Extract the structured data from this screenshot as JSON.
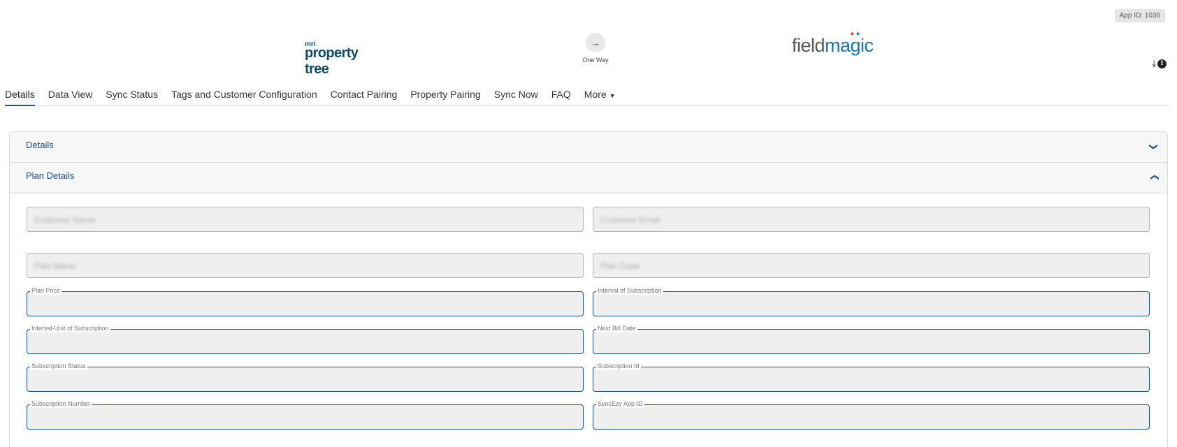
{
  "app_id": "App ID: 1036",
  "header": {
    "left_logo_prefix": "mri",
    "left_logo_name": "property tree",
    "sync_direction_label": "One Way",
    "right_logo_part1": "field",
    "right_logo_part2": "magic"
  },
  "tabs": [
    {
      "label": "Details"
    },
    {
      "label": "Data View"
    },
    {
      "label": "Sync Status"
    },
    {
      "label": "Tags and Customer Configuration"
    },
    {
      "label": "Contact Pairing"
    },
    {
      "label": "Property Pairing"
    },
    {
      "label": "Sync Now"
    },
    {
      "label": "FAQ"
    },
    {
      "label": "More"
    }
  ],
  "accordion": {
    "details_title": "Details",
    "plan_details_title": "Plan Details"
  },
  "fields": {
    "customer_name": {
      "placeholder": "Customer Name"
    },
    "customer_email": {
      "placeholder": "Customer Email"
    },
    "plan_name": {
      "placeholder": "Plan Name"
    },
    "plan_code": {
      "placeholder": "Plan Code"
    },
    "plan_price": {
      "label": "Plan Price",
      "value": ""
    },
    "interval_of_subscription": {
      "label": "Interval of Subscription",
      "value": ""
    },
    "interval_unit_of_subscription": {
      "label": "Interval-Unit of Subscription",
      "value": ""
    },
    "next_bill_date": {
      "label": "Next Bill Date",
      "value": ""
    },
    "subscription_status": {
      "label": "Subscription Status",
      "value": ""
    },
    "subscription_id": {
      "label": "Subscription Id",
      "value": ""
    },
    "subscription_number": {
      "label": "Subscription Number",
      "value": ""
    },
    "syncezy_app_id": {
      "label": "SyncEzy App ID",
      "value": ""
    }
  },
  "colors": {
    "accent": "#1a4fa0",
    "field_bg": "#efefef"
  }
}
